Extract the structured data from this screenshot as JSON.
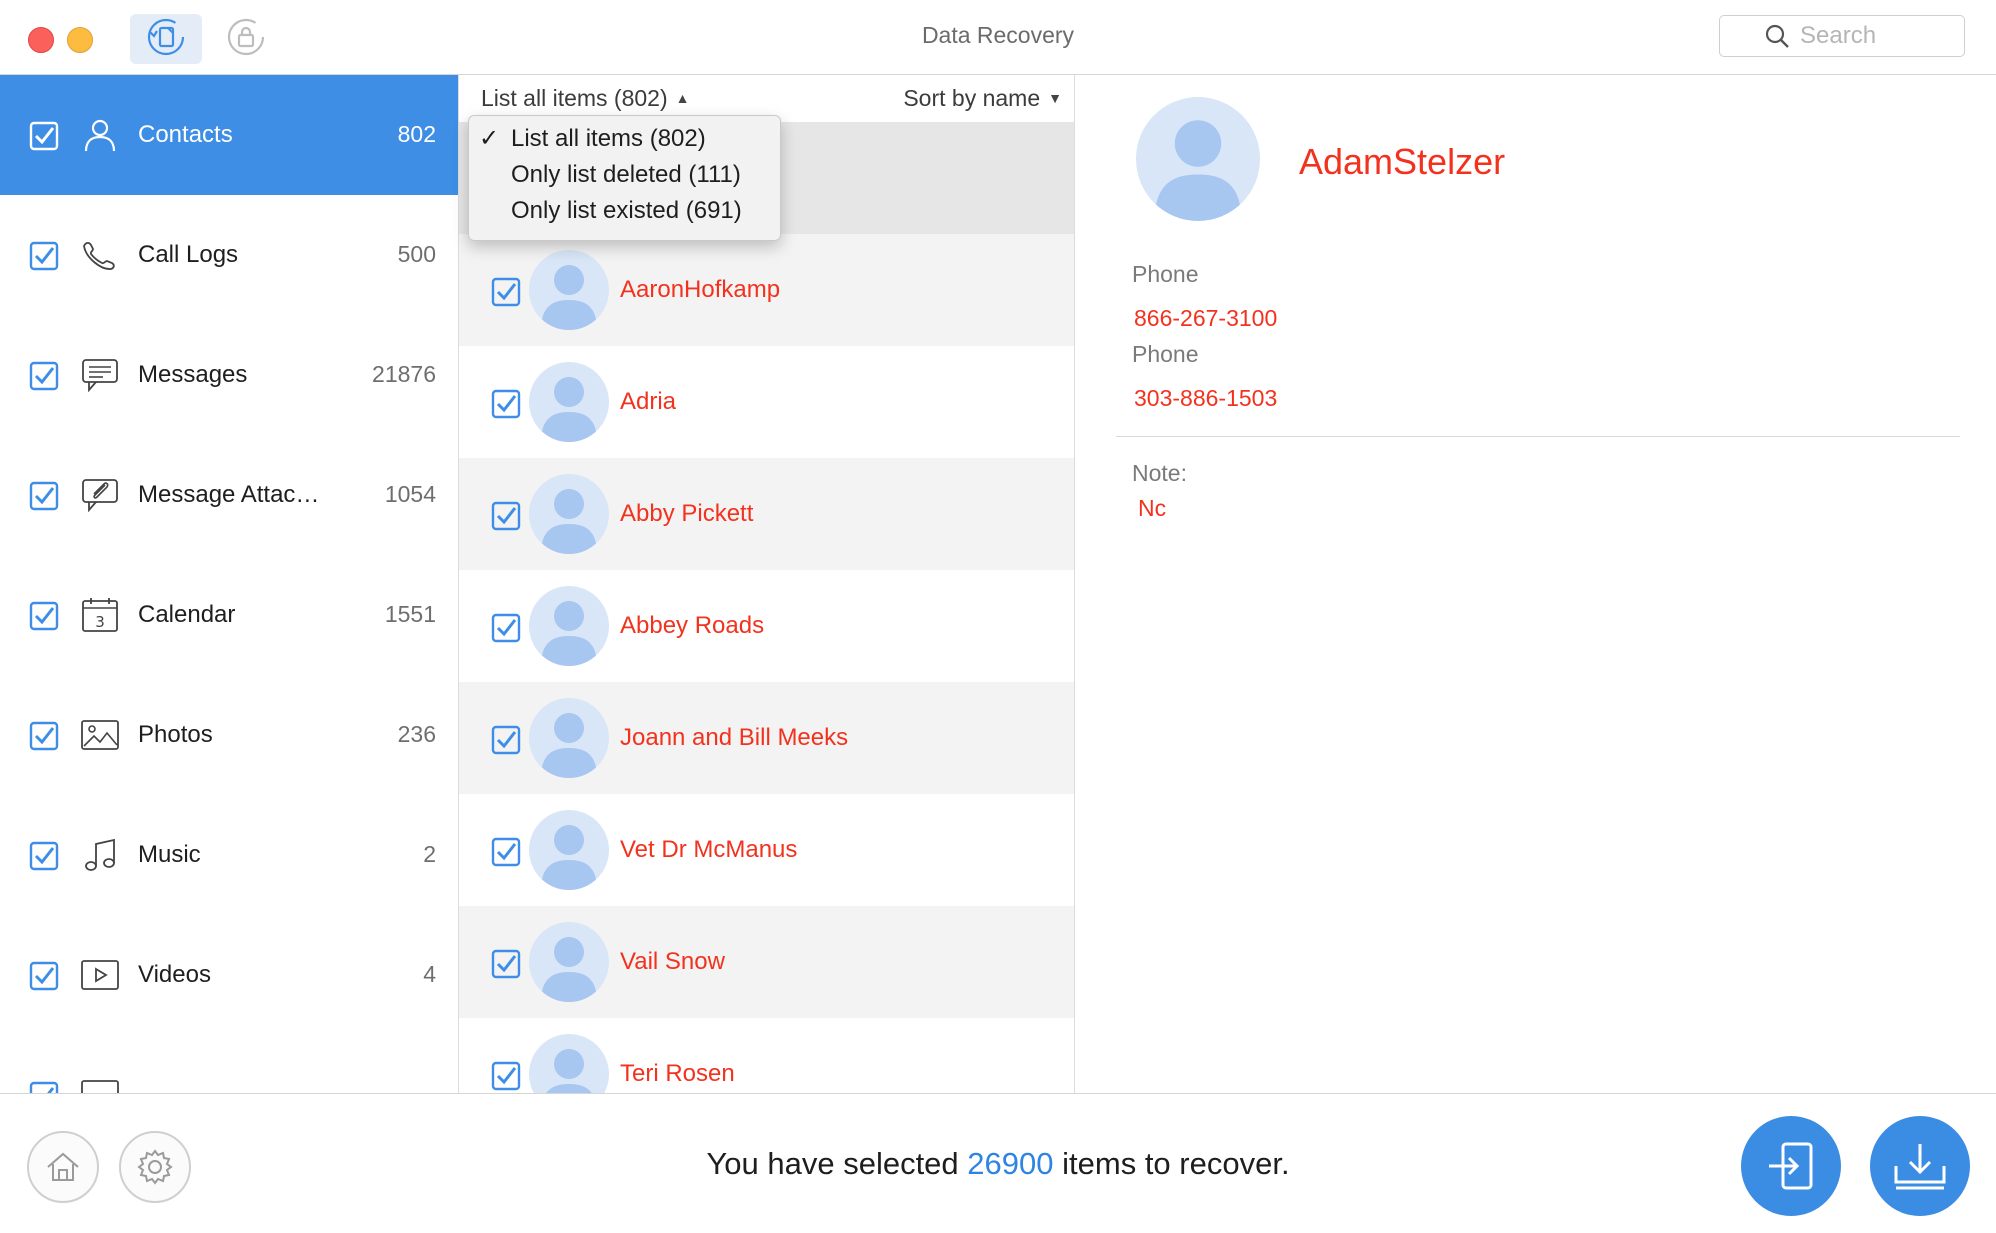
{
  "window": {
    "title": "Data Recovery"
  },
  "toolbar": {
    "search_placeholder": "Search",
    "recover_from_device_icon": "device-recovery-icon",
    "recover_from_backup_icon": "backup-lock-icon"
  },
  "sidebar": {
    "items": [
      {
        "label": "Contacts",
        "count": "802",
        "icon": "person-icon",
        "checked": true,
        "active": true
      },
      {
        "label": "Call Logs",
        "count": "500",
        "icon": "phone-icon",
        "checked": true
      },
      {
        "label": "Messages",
        "count": "21876",
        "icon": "message-icon",
        "checked": true
      },
      {
        "label": "Message Attac…",
        "count": "1054",
        "icon": "attachment-icon",
        "checked": true
      },
      {
        "label": "Calendar",
        "count": "1551",
        "icon": "calendar-icon",
        "checked": true
      },
      {
        "label": "Photos",
        "count": "236",
        "icon": "photo-icon",
        "checked": true
      },
      {
        "label": "Music",
        "count": "2",
        "icon": "music-icon",
        "checked": true
      },
      {
        "label": "Videos",
        "count": "4",
        "icon": "video-icon",
        "checked": true
      }
    ]
  },
  "list": {
    "filter_label": "List all items (802)",
    "sort_label": "Sort by name",
    "dropdown": [
      {
        "label": "List all items (802)",
        "checked": true
      },
      {
        "label": "Only list deleted (111)",
        "checked": false
      },
      {
        "label": "Only list existed (691)",
        "checked": false
      }
    ],
    "rows": [
      {
        "name": "AaronHofkamp"
      },
      {
        "name": "Adria"
      },
      {
        "name": "Abby Pickett"
      },
      {
        "name": "Abbey Roads"
      },
      {
        "name": "Joann and Bill Meeks"
      },
      {
        "name": "Vet Dr McManus"
      },
      {
        "name": "Vail Snow"
      },
      {
        "name": "Teri Rosen"
      }
    ]
  },
  "detail": {
    "name": "AdamStelzer",
    "phone_label_1": "Phone",
    "phone_value_1": "866-267-3100",
    "phone_label_2": "Phone",
    "phone_value_2": "303-886-1503",
    "note_label": "Note:",
    "note_value": "Nc"
  },
  "footer": {
    "status_prefix": "You have selected",
    "selected_count": "26900",
    "status_suffix": "items to recover.",
    "home_icon": "home-icon",
    "settings_icon": "gear-icon",
    "export_to_device_icon": "export-to-device-icon",
    "download_to_computer_icon": "download-icon"
  },
  "colors": {
    "accent": "#3e8ee6",
    "deleted_text": "#f3321e",
    "avatar_bg": "#d8e6f8"
  }
}
